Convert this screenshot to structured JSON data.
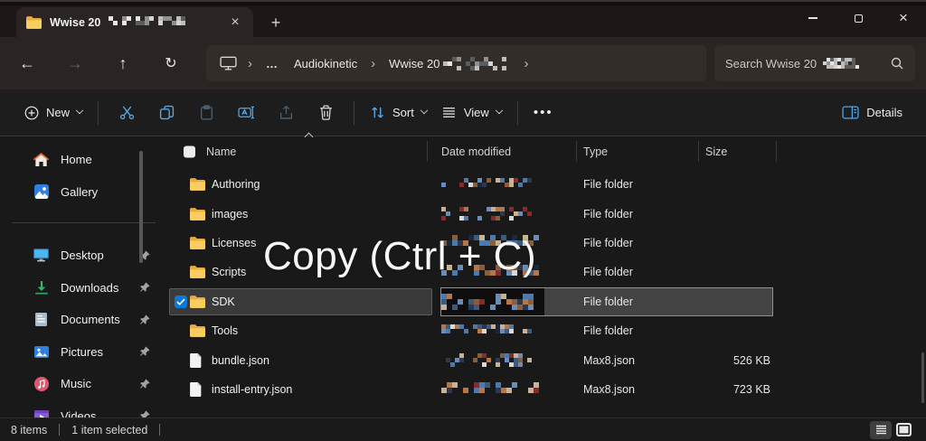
{
  "titlebar": {
    "tab_title": "Wwise 20"
  },
  "glyphs": {
    "close": "×",
    "plus": "+",
    "back": "←",
    "forward": "→",
    "up": "↑",
    "refresh": "↻",
    "crumb_sep": "›",
    "ellipsis": "…",
    "more": "•••"
  },
  "nav": {
    "breadcrumb": {
      "ellipsis": "…",
      "folder1": "Audiokinetic",
      "folder2_prefix": "Wwise 20"
    },
    "search_prefix": "Search Wwise 20"
  },
  "toolbar": {
    "new_label": "New",
    "sort_label": "Sort",
    "view_label": "View",
    "details_label": "Details"
  },
  "sidebar": {
    "items": [
      {
        "label": "Home",
        "pinned": false
      },
      {
        "label": "Gallery",
        "pinned": false
      },
      {
        "label": "Desktop",
        "pinned": true
      },
      {
        "label": "Downloads",
        "pinned": true
      },
      {
        "label": "Documents",
        "pinned": true
      },
      {
        "label": "Pictures",
        "pinned": true
      },
      {
        "label": "Music",
        "pinned": true
      },
      {
        "label": "Videos",
        "pinned": true
      }
    ]
  },
  "files": {
    "columns": {
      "name": "Name",
      "date": "Date modified",
      "type": "Type",
      "size": "Size"
    },
    "rows": [
      {
        "name": "Authoring",
        "type": "File folder",
        "size": "",
        "icon": "folder",
        "selected": false
      },
      {
        "name": "images",
        "type": "File folder",
        "size": "",
        "icon": "folder",
        "selected": false
      },
      {
        "name": "Licenses",
        "type": "File folder",
        "size": "",
        "icon": "folder",
        "selected": false
      },
      {
        "name": "Scripts",
        "type": "File folder",
        "size": "",
        "icon": "folder",
        "selected": false
      },
      {
        "name": "SDK",
        "type": "File folder",
        "size": "",
        "icon": "folder",
        "selected": true
      },
      {
        "name": "Tools",
        "type": "File folder",
        "size": "",
        "icon": "folder",
        "selected": false
      },
      {
        "name": "bundle.json",
        "type": "Max8.json",
        "size": "526 KB",
        "icon": "file",
        "selected": false
      },
      {
        "name": "install-entry.json",
        "type": "Max8.json",
        "size": "723 KB",
        "icon": "file",
        "selected": false
      }
    ]
  },
  "statusbar": {
    "count": "8 items",
    "selected": "1 item selected"
  },
  "overlay": {
    "label": "Copy (Ctrl + C)"
  },
  "colors": {
    "accent_blue": "#53a7e8",
    "folder_yellow": "#f8ce61",
    "checkbox_blue": "#0c78d4",
    "selection_gray": "#434343"
  },
  "redaction_palettes": {
    "color": [
      "#3d5a7a",
      "#6b8cb5",
      "#c8b293",
      "#8a5d3b",
      "#842c2c",
      "#d9d9d9",
      "#2b3850",
      "#b5764a",
      "#4a7ab0",
      "#1c2738"
    ],
    "gray": [
      "#e6e6e6",
      "#bdbdbd",
      "#8f8f8f",
      "#5c5c5c",
      "#d4d4d4"
    ]
  }
}
